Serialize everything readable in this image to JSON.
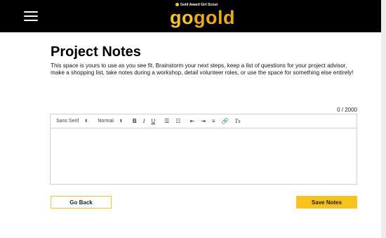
{
  "header": {
    "logo_tagline": "Gold Award Girl Scout",
    "logo_go": "go",
    "logo_gold": "gold",
    "brand_yellow": "#f2c230",
    "background": "#000000"
  },
  "main": {
    "title": "Project Notes",
    "description": "This space is yours to use as you see fit. Brainstorm your next steps, keep a list of questions for your project advisor, make a shopping list, take notes during a workshop, detail volunteer roles, or use the space for something else entirely!",
    "char_count": "0 / 2000"
  },
  "editor": {
    "font_select": "Sans Serif",
    "size_select": "Normal",
    "bold": "B",
    "italic": "I",
    "underline": "U",
    "ordered_list": "☰",
    "bullet_list": "☷",
    "outdent": "⇤",
    "indent": "⇥",
    "align": "≡",
    "link": "🔗",
    "clean": "Tx",
    "select_caret": "⬍",
    "content": ""
  },
  "actions": {
    "back_label": "Go Back",
    "save_label": "Save Notes",
    "save_color": "#f9c31f"
  }
}
